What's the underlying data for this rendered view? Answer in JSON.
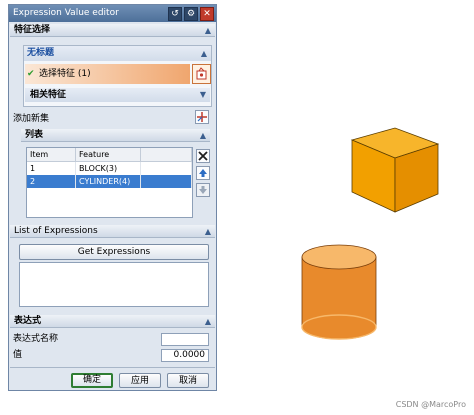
{
  "dialog": {
    "title": "Expression Value editor",
    "feature_select": {
      "header": "特征选择",
      "sub_header": "无标题",
      "select_label": "选择特征 (1)",
      "related_label": "相关特征"
    },
    "add_set_label": "添加新集",
    "list": {
      "header": "列表",
      "columns": [
        "Item",
        "Feature"
      ],
      "rows": [
        {
          "item": "1",
          "feature": "BLOCK(3)"
        },
        {
          "item": "2",
          "feature": "CYLINDER(4)"
        }
      ],
      "selected_row": 2
    },
    "expressions": {
      "header": "List of Expressions",
      "get_button": "Get Expressions"
    },
    "expression": {
      "header": "表达式",
      "name_label": "表达式名称",
      "name_value": "",
      "value_label": "值",
      "value_value": "0.0000"
    },
    "footer": {
      "ok": "确定",
      "apply": "应用",
      "cancel": "取消"
    }
  },
  "watermark": "CSDN @MarcoPro",
  "colors": {
    "block": "#f2a000",
    "cylinder": "#f4a040",
    "selected_row": "#3a7ccf",
    "ok_border": "#2e7d32"
  }
}
